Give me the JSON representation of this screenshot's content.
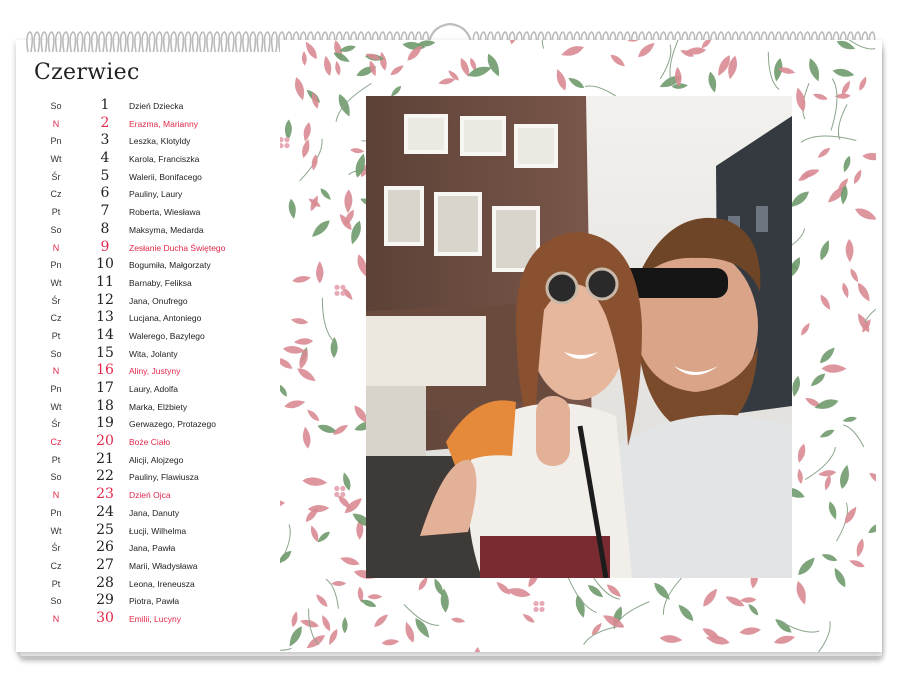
{
  "calendar": {
    "month": "Czerwiec",
    "days": [
      {
        "abbr": "So",
        "num": "1",
        "names": "Dzień Dziecka",
        "holiday": false
      },
      {
        "abbr": "N",
        "num": "2",
        "names": "Erazma, Marianny",
        "holiday": true
      },
      {
        "abbr": "Pn",
        "num": "3",
        "names": "Leszka, Klotyldy",
        "holiday": false
      },
      {
        "abbr": "Wt",
        "num": "4",
        "names": "Karola, Franciszka",
        "holiday": false
      },
      {
        "abbr": "Śr",
        "num": "5",
        "names": "Walerii, Bonifacego",
        "holiday": false
      },
      {
        "abbr": "Cz",
        "num": "6",
        "names": "Pauliny, Laury",
        "holiday": false
      },
      {
        "abbr": "Pt",
        "num": "7",
        "names": "Roberta, Wiesława",
        "holiday": false
      },
      {
        "abbr": "So",
        "num": "8",
        "names": "Maksyma, Medarda",
        "holiday": false
      },
      {
        "abbr": "N",
        "num": "9",
        "names": "Zesłanie Ducha Świętego",
        "holiday": true
      },
      {
        "abbr": "Pn",
        "num": "10",
        "names": "Bogumiła, Małgorzaty",
        "holiday": false
      },
      {
        "abbr": "Wt",
        "num": "11",
        "names": "Barnaby, Feliksa",
        "holiday": false
      },
      {
        "abbr": "Śr",
        "num": "12",
        "names": "Jana, Onufrego",
        "holiday": false
      },
      {
        "abbr": "Cz",
        "num": "13",
        "names": "Lucjana, Antoniego",
        "holiday": false
      },
      {
        "abbr": "Pt",
        "num": "14",
        "names": "Walerego, Bazylego",
        "holiday": false
      },
      {
        "abbr": "So",
        "num": "15",
        "names": "Wita, Jolanty",
        "holiday": false
      },
      {
        "abbr": "N",
        "num": "16",
        "names": "Aliny, Justyny",
        "holiday": true
      },
      {
        "abbr": "Pn",
        "num": "17",
        "names": "Laury, Adolfa",
        "holiday": false
      },
      {
        "abbr": "Wt",
        "num": "18",
        "names": "Marka, Elżbiety",
        "holiday": false
      },
      {
        "abbr": "Śr",
        "num": "19",
        "names": "Gerwazego, Protazego",
        "holiday": false
      },
      {
        "abbr": "Cz",
        "num": "20",
        "names": "Boże Ciało",
        "holiday": true
      },
      {
        "abbr": "Pt",
        "num": "21",
        "names": "Alicji, Alojzego",
        "holiday": false
      },
      {
        "abbr": "So",
        "num": "22",
        "names": "Pauliny, Flawiusza",
        "holiday": false
      },
      {
        "abbr": "N",
        "num": "23",
        "names": "Dzień Ojca",
        "holiday": true
      },
      {
        "abbr": "Pn",
        "num": "24",
        "names": "Jana, Danuty",
        "holiday": false
      },
      {
        "abbr": "Wt",
        "num": "25",
        "names": "Łucji, Wilhelma",
        "holiday": false
      },
      {
        "abbr": "Śr",
        "num": "26",
        "names": "Jana, Pawła",
        "holiday": false
      },
      {
        "abbr": "Cz",
        "num": "27",
        "names": "Marii, Władysława",
        "holiday": false
      },
      {
        "abbr": "Pt",
        "num": "28",
        "names": "Leona, Ireneusza",
        "holiday": false
      },
      {
        "abbr": "So",
        "num": "29",
        "names": "Piotra, Pawła",
        "holiday": false
      },
      {
        "abbr": "N",
        "num": "30",
        "names": "Emilii, Lucyny",
        "holiday": true
      }
    ]
  },
  "colors": {
    "holiday_red": "#e0284a",
    "leaf_pink": "#d98b94",
    "leaf_green": "#6f9a6b",
    "berry_pink": "#e7a9b6"
  }
}
